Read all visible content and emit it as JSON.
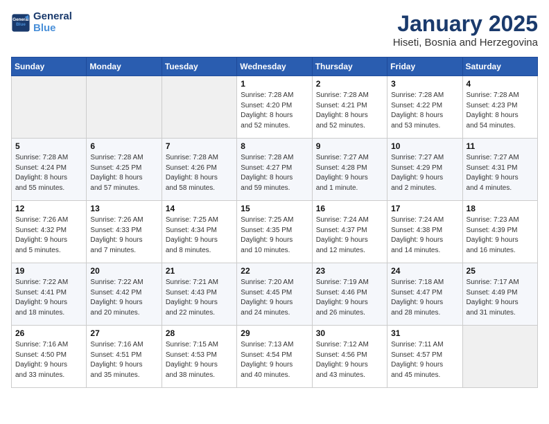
{
  "logo": {
    "line1": "General",
    "line2": "Blue"
  },
  "title": "January 2025",
  "subtitle": "Hiseti, Bosnia and Herzegovina",
  "days_of_week": [
    "Sunday",
    "Monday",
    "Tuesday",
    "Wednesday",
    "Thursday",
    "Friday",
    "Saturday"
  ],
  "weeks": [
    [
      {
        "day": "",
        "detail": ""
      },
      {
        "day": "",
        "detail": ""
      },
      {
        "day": "",
        "detail": ""
      },
      {
        "day": "1",
        "detail": "Sunrise: 7:28 AM\nSunset: 4:20 PM\nDaylight: 8 hours\nand 52 minutes."
      },
      {
        "day": "2",
        "detail": "Sunrise: 7:28 AM\nSunset: 4:21 PM\nDaylight: 8 hours\nand 52 minutes."
      },
      {
        "day": "3",
        "detail": "Sunrise: 7:28 AM\nSunset: 4:22 PM\nDaylight: 8 hours\nand 53 minutes."
      },
      {
        "day": "4",
        "detail": "Sunrise: 7:28 AM\nSunset: 4:23 PM\nDaylight: 8 hours\nand 54 minutes."
      }
    ],
    [
      {
        "day": "5",
        "detail": "Sunrise: 7:28 AM\nSunset: 4:24 PM\nDaylight: 8 hours\nand 55 minutes."
      },
      {
        "day": "6",
        "detail": "Sunrise: 7:28 AM\nSunset: 4:25 PM\nDaylight: 8 hours\nand 57 minutes."
      },
      {
        "day": "7",
        "detail": "Sunrise: 7:28 AM\nSunset: 4:26 PM\nDaylight: 8 hours\nand 58 minutes."
      },
      {
        "day": "8",
        "detail": "Sunrise: 7:28 AM\nSunset: 4:27 PM\nDaylight: 8 hours\nand 59 minutes."
      },
      {
        "day": "9",
        "detail": "Sunrise: 7:27 AM\nSunset: 4:28 PM\nDaylight: 9 hours\nand 1 minute."
      },
      {
        "day": "10",
        "detail": "Sunrise: 7:27 AM\nSunset: 4:29 PM\nDaylight: 9 hours\nand 2 minutes."
      },
      {
        "day": "11",
        "detail": "Sunrise: 7:27 AM\nSunset: 4:31 PM\nDaylight: 9 hours\nand 4 minutes."
      }
    ],
    [
      {
        "day": "12",
        "detail": "Sunrise: 7:26 AM\nSunset: 4:32 PM\nDaylight: 9 hours\nand 5 minutes."
      },
      {
        "day": "13",
        "detail": "Sunrise: 7:26 AM\nSunset: 4:33 PM\nDaylight: 9 hours\nand 7 minutes."
      },
      {
        "day": "14",
        "detail": "Sunrise: 7:25 AM\nSunset: 4:34 PM\nDaylight: 9 hours\nand 8 minutes."
      },
      {
        "day": "15",
        "detail": "Sunrise: 7:25 AM\nSunset: 4:35 PM\nDaylight: 9 hours\nand 10 minutes."
      },
      {
        "day": "16",
        "detail": "Sunrise: 7:24 AM\nSunset: 4:37 PM\nDaylight: 9 hours\nand 12 minutes."
      },
      {
        "day": "17",
        "detail": "Sunrise: 7:24 AM\nSunset: 4:38 PM\nDaylight: 9 hours\nand 14 minutes."
      },
      {
        "day": "18",
        "detail": "Sunrise: 7:23 AM\nSunset: 4:39 PM\nDaylight: 9 hours\nand 16 minutes."
      }
    ],
    [
      {
        "day": "19",
        "detail": "Sunrise: 7:22 AM\nSunset: 4:41 PM\nDaylight: 9 hours\nand 18 minutes."
      },
      {
        "day": "20",
        "detail": "Sunrise: 7:22 AM\nSunset: 4:42 PM\nDaylight: 9 hours\nand 20 minutes."
      },
      {
        "day": "21",
        "detail": "Sunrise: 7:21 AM\nSunset: 4:43 PM\nDaylight: 9 hours\nand 22 minutes."
      },
      {
        "day": "22",
        "detail": "Sunrise: 7:20 AM\nSunset: 4:45 PM\nDaylight: 9 hours\nand 24 minutes."
      },
      {
        "day": "23",
        "detail": "Sunrise: 7:19 AM\nSunset: 4:46 PM\nDaylight: 9 hours\nand 26 minutes."
      },
      {
        "day": "24",
        "detail": "Sunrise: 7:18 AM\nSunset: 4:47 PM\nDaylight: 9 hours\nand 28 minutes."
      },
      {
        "day": "25",
        "detail": "Sunrise: 7:17 AM\nSunset: 4:49 PM\nDaylight: 9 hours\nand 31 minutes."
      }
    ],
    [
      {
        "day": "26",
        "detail": "Sunrise: 7:16 AM\nSunset: 4:50 PM\nDaylight: 9 hours\nand 33 minutes."
      },
      {
        "day": "27",
        "detail": "Sunrise: 7:16 AM\nSunset: 4:51 PM\nDaylight: 9 hours\nand 35 minutes."
      },
      {
        "day": "28",
        "detail": "Sunrise: 7:15 AM\nSunset: 4:53 PM\nDaylight: 9 hours\nand 38 minutes."
      },
      {
        "day": "29",
        "detail": "Sunrise: 7:13 AM\nSunset: 4:54 PM\nDaylight: 9 hours\nand 40 minutes."
      },
      {
        "day": "30",
        "detail": "Sunrise: 7:12 AM\nSunset: 4:56 PM\nDaylight: 9 hours\nand 43 minutes."
      },
      {
        "day": "31",
        "detail": "Sunrise: 7:11 AM\nSunset: 4:57 PM\nDaylight: 9 hours\nand 45 minutes."
      },
      {
        "day": "",
        "detail": ""
      }
    ]
  ]
}
